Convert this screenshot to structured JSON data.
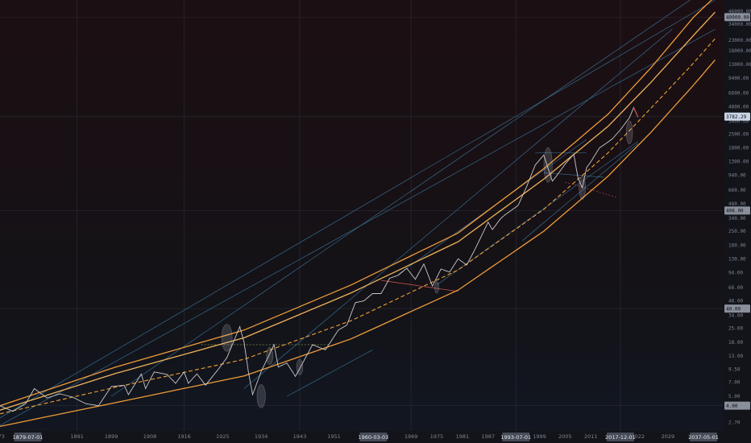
{
  "chart_data": {
    "type": "line",
    "title": "",
    "scale": "log",
    "grid": true,
    "y_tick_labels": [
      "46000.00",
      "34000.00",
      "23000.00",
      "18000.00",
      "13000.00",
      "9400.00",
      "6600.00",
      "4800.00",
      "3400.00",
      "2500.00",
      "1800.00",
      "1300.00",
      "940.00",
      "660.00",
      "480.00",
      "340.00",
      "250.00",
      "180.00",
      "130.00",
      "94.00",
      "66.00",
      "48.00",
      "34.00",
      "25.00",
      "18.00",
      "13.00",
      "9.50",
      "7.00",
      "5.00",
      "2.70"
    ],
    "y_badges": [
      {
        "label": "40000.00",
        "value": 40000,
        "style": "grey"
      },
      {
        "label": "3782.29",
        "value": 3782.29,
        "style": "light"
      },
      {
        "label": "408.00",
        "value": 408,
        "style": "grey"
      },
      {
        "label": "40.00",
        "value": 40,
        "style": "grey"
      },
      {
        "label": "4.00",
        "value": 4,
        "style": "grey"
      }
    ],
    "x_tick_labels": [
      "73",
      "1891",
      "1899",
      "1908",
      "1916",
      "1925",
      "1934",
      "1943",
      "1951",
      "19",
      "43",
      "1969",
      "1975",
      "1981",
      "1987",
      "1999",
      "2005",
      "2011",
      "2022",
      "2029",
      "20"
    ],
    "x_badges": [
      {
        "label": "1879-07-01",
        "year": 1879.5
      },
      {
        "label": "1960-03-01",
        "year": 1960.2
      },
      {
        "label": "1993-07-01",
        "year": 1993.5
      },
      {
        "label": "2017-12-01",
        "year": 2017.9
      },
      {
        "label": "2037-05-01",
        "year": 2037.3
      }
    ],
    "x_range": [
      1873,
      2042
    ],
    "y_range": [
      2.2,
      60000
    ],
    "series": [
      {
        "type": "price",
        "color": "#c9c9c9",
        "points": [
          [
            1873,
            4.0
          ],
          [
            1876,
            3.5
          ],
          [
            1879,
            4.2
          ],
          [
            1881,
            6.0
          ],
          [
            1884,
            4.8
          ],
          [
            1887,
            5.3
          ],
          [
            1890,
            4.9
          ],
          [
            1893,
            4.2
          ],
          [
            1896,
            4.0
          ],
          [
            1899,
            6.3
          ],
          [
            1902,
            6.5
          ],
          [
            1903,
            5.2
          ],
          [
            1906,
            8.5
          ],
          [
            1907,
            6.0
          ],
          [
            1909,
            8.9
          ],
          [
            1912,
            8.4
          ],
          [
            1914,
            6.8
          ],
          [
            1916,
            8.9
          ],
          [
            1917,
            6.8
          ],
          [
            1919,
            8.5
          ],
          [
            1921,
            6.5
          ],
          [
            1924,
            9.5
          ],
          [
            1926,
            12.5
          ],
          [
            1929,
            26
          ],
          [
            1930,
            18
          ],
          [
            1931,
            9
          ],
          [
            1932,
            5.2
          ],
          [
            1934,
            9
          ],
          [
            1937,
            17
          ],
          [
            1938,
            10
          ],
          [
            1940,
            11
          ],
          [
            1942,
            8
          ],
          [
            1946,
            17
          ],
          [
            1949,
            15
          ],
          [
            1952,
            24
          ],
          [
            1954,
            27
          ],
          [
            1956,
            46
          ],
          [
            1958,
            48
          ],
          [
            1960,
            57
          ],
          [
            1962,
            57
          ],
          [
            1964,
            82
          ],
          [
            1966,
            88
          ],
          [
            1968,
            104
          ],
          [
            1970,
            80
          ],
          [
            1972,
            115
          ],
          [
            1974,
            68
          ],
          [
            1976,
            102
          ],
          [
            1978,
            95
          ],
          [
            1980,
            130
          ],
          [
            1982,
            112
          ],
          [
            1984,
            165
          ],
          [
            1987,
            310
          ],
          [
            1988,
            260
          ],
          [
            1990,
            340
          ],
          [
            1991,
            370
          ],
          [
            1994,
            460
          ],
          [
            1996,
            720
          ],
          [
            1998,
            1200
          ],
          [
            2000,
            1520
          ],
          [
            2002,
            820
          ],
          [
            2003,
            930
          ],
          [
            2005,
            1230
          ],
          [
            2007,
            1550
          ],
          [
            2008,
            880
          ],
          [
            2009,
            700
          ],
          [
            2010,
            1130
          ],
          [
            2011,
            1300
          ],
          [
            2013,
            1800
          ],
          [
            2015,
            2070
          ],
          [
            2016,
            2230
          ],
          [
            2018,
            2800
          ],
          [
            2019,
            3220
          ],
          [
            2020,
            3680
          ],
          [
            2021,
            4700
          ],
          [
            2022,
            3750
          ]
        ]
      },
      {
        "type": "upper-curve",
        "color": "#ee9b3a",
        "points": [
          [
            1873,
            4.0
          ],
          [
            1900,
            10
          ],
          [
            1930,
            24
          ],
          [
            1955,
            70
          ],
          [
            1980,
            240
          ],
          [
            2000,
            1100
          ],
          [
            2015,
            4000
          ],
          [
            2025,
            12000
          ],
          [
            2035,
            40000
          ],
          [
            2040,
            65000
          ]
        ]
      },
      {
        "type": "upper-curve-2",
        "color": "#f0b35a",
        "points": [
          [
            1873,
            3.6
          ],
          [
            1900,
            8.6
          ],
          [
            1930,
            20
          ],
          [
            1955,
            58
          ],
          [
            1980,
            195
          ],
          [
            2000,
            860
          ],
          [
            2015,
            3000
          ],
          [
            2025,
            8500
          ],
          [
            2035,
            26000
          ],
          [
            2040,
            45000
          ]
        ]
      },
      {
        "type": "mid-curve",
        "color": "#f0a035",
        "points": [
          [
            1873,
            3.3
          ],
          [
            1900,
            6.2
          ],
          [
            1930,
            12
          ],
          [
            1955,
            30
          ],
          [
            1980,
            100
          ],
          [
            2000,
            420
          ],
          [
            2015,
            1600
          ],
          [
            2025,
            4600
          ],
          [
            2035,
            13500
          ],
          [
            2040,
            24000
          ]
        ]
      },
      {
        "type": "lower-curve",
        "color": "#ee9b3a",
        "points": [
          [
            1873,
            2.45
          ],
          [
            1900,
            4.3
          ],
          [
            1930,
            8.1
          ],
          [
            1955,
            19.5
          ],
          [
            1980,
            62
          ],
          [
            2000,
            250
          ],
          [
            2015,
            920
          ],
          [
            2025,
            2600
          ],
          [
            2035,
            8000
          ],
          [
            2040,
            14500
          ]
        ]
      }
    ]
  }
}
